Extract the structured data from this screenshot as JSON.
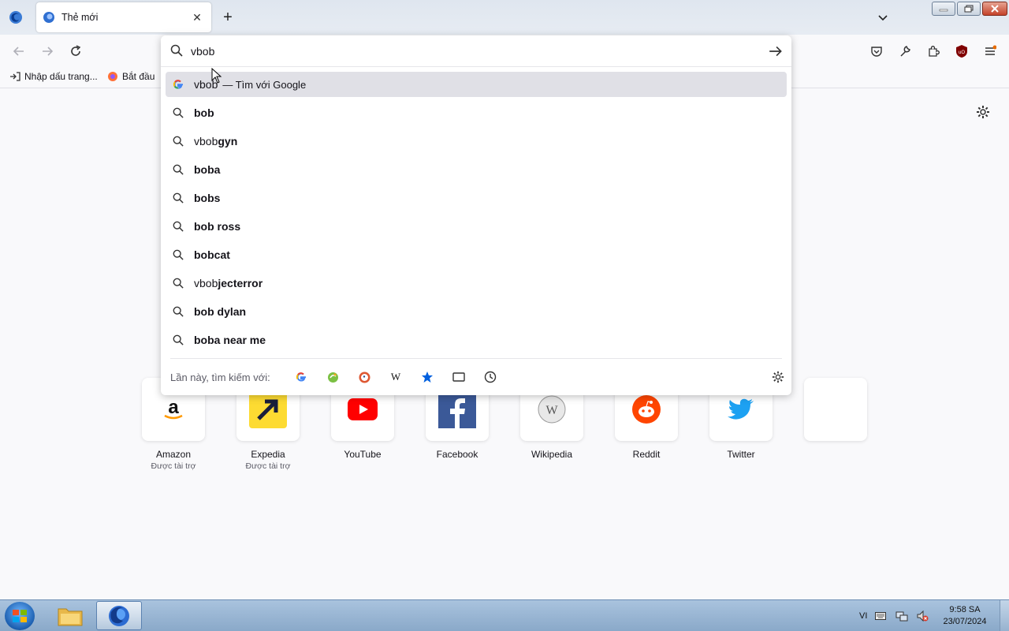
{
  "browser": {
    "tab": {
      "title": "Thẻ mới"
    },
    "bookmarks": [
      {
        "label": "Nhập dấu trang..."
      },
      {
        "label": "Bắt đầu"
      }
    ]
  },
  "urlbar": {
    "value": "vbob",
    "results": [
      {
        "typed": "vbob",
        "rest": "",
        "action": "— Tìm với Google",
        "icon": "google-icon",
        "selected": true
      },
      {
        "typed": "",
        "rest": "bob",
        "icon": "search-icon"
      },
      {
        "typed": "vbob",
        "rest": "gyn",
        "icon": "search-icon"
      },
      {
        "typed": "",
        "rest": "boba",
        "icon": "search-icon"
      },
      {
        "typed": "",
        "rest": "bobs",
        "icon": "search-icon"
      },
      {
        "typed": "",
        "rest": "bob ross",
        "icon": "search-icon"
      },
      {
        "typed": "",
        "rest": "bobcat",
        "icon": "search-icon"
      },
      {
        "typed": "vbob",
        "rest": "jecterror",
        "icon": "search-icon"
      },
      {
        "typed": "",
        "rest": "bob dylan",
        "icon": "search-icon"
      },
      {
        "typed": "",
        "rest": "boba near me",
        "icon": "search-icon"
      }
    ],
    "oneoff_label": "Lần này, tìm kiếm với:",
    "engines": [
      "google-icon",
      "bing-icon",
      "duckduckgo-icon",
      "wikipedia-icon",
      "bookmarks-star-icon",
      "tabs-icon",
      "history-clock-icon"
    ]
  },
  "top_sites": [
    {
      "name": "Amazon",
      "sponsor": "Được tài trợ"
    },
    {
      "name": "Expedia",
      "sponsor": "Được tài trợ"
    },
    {
      "name": "YouTube",
      "sponsor": ""
    },
    {
      "name": "Facebook",
      "sponsor": ""
    },
    {
      "name": "Wikipedia",
      "sponsor": ""
    },
    {
      "name": "Reddit",
      "sponsor": ""
    },
    {
      "name": "Twitter",
      "sponsor": ""
    }
  ],
  "taskbar": {
    "language": "VI",
    "time": "9:58 SA",
    "date": "23/07/2024"
  },
  "colors": {
    "accent": "#0060df",
    "selected_row": "#e0e0e6",
    "taskbar": "#8aa9c9"
  }
}
